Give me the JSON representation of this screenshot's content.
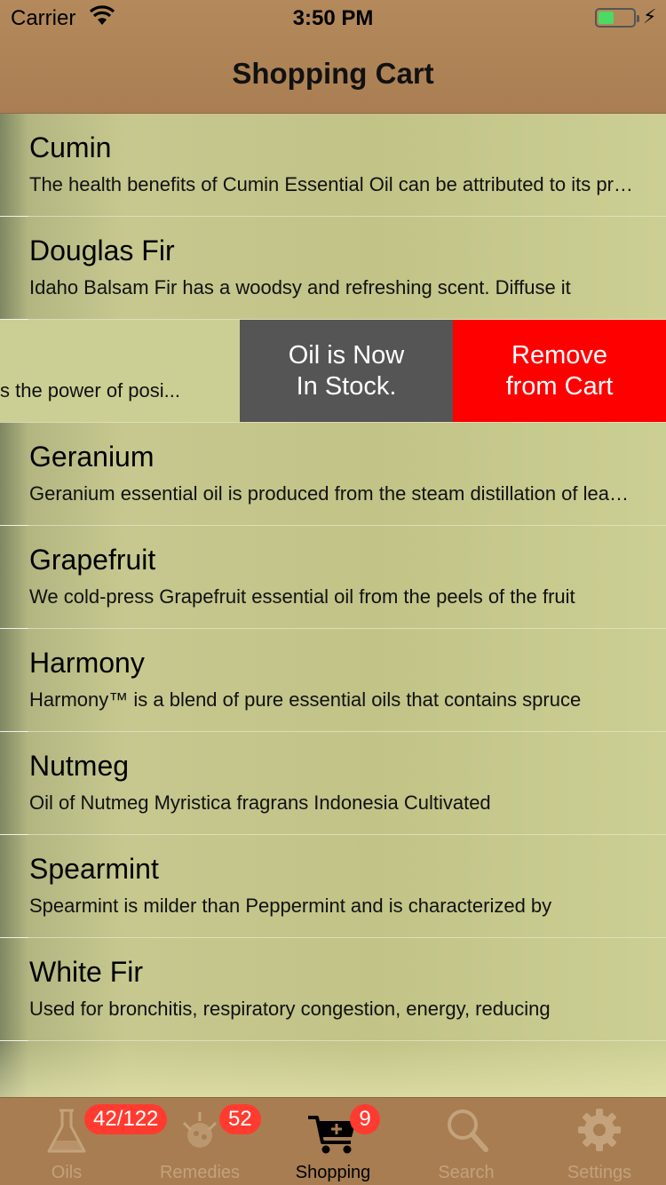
{
  "status_bar": {
    "carrier": "Carrier",
    "time": "3:50 PM",
    "battery_level": 0.45,
    "wifi_icon": "wifi-icon",
    "battery_icon": "battery-charging-icon"
  },
  "nav": {
    "title": "Shopping Cart"
  },
  "items": [
    {
      "name": "Cumin",
      "description": "The health benefits of Cumin Essential Oil can be attributed to its properties"
    },
    {
      "name": "Douglas Fir",
      "description": "Idaho Balsam Fir has a woodsy and refreshing scent. Diffuse it"
    },
    {
      "name": "",
      "description": "s the power of posi..."
    },
    {
      "name": "Geranium",
      "description": "Geranium essential oil is produced from the steam distillation of leaves"
    },
    {
      "name": "Grapefruit",
      "description": "We cold-press Grapefruit essential oil from the peels of the fruit"
    },
    {
      "name": "Harmony",
      "description": "Harmony™ is a blend of pure essential oils that contains spruce"
    },
    {
      "name": "Nutmeg",
      "description": "Oil of Nutmeg Myristica fragrans Indonesia Cultivated"
    },
    {
      "name": "Spearmint",
      "description": "Spearmint is milder than Peppermint and is characterized by"
    },
    {
      "name": "White Fir",
      "description": "Used for bronchitis, respiratory congestion, energy, reducing"
    }
  ],
  "swipe_actions": {
    "in_stock_label": "Oil is Now\nIn Stock.",
    "remove_label": "Remove\nfrom Cart",
    "in_stock_color": "#555555",
    "remove_color": "#ff0000"
  },
  "tabs": [
    {
      "label": "Oils",
      "icon": "flask-icon",
      "badge": "42/122"
    },
    {
      "label": "Remedies",
      "icon": "remedies-icon",
      "badge": "52"
    },
    {
      "label": "Shopping",
      "icon": "cart-icon",
      "badge": "9",
      "active": true
    },
    {
      "label": "Search",
      "icon": "search-icon",
      "badge": ""
    },
    {
      "label": "Settings",
      "icon": "gear-icon",
      "badge": ""
    }
  ]
}
